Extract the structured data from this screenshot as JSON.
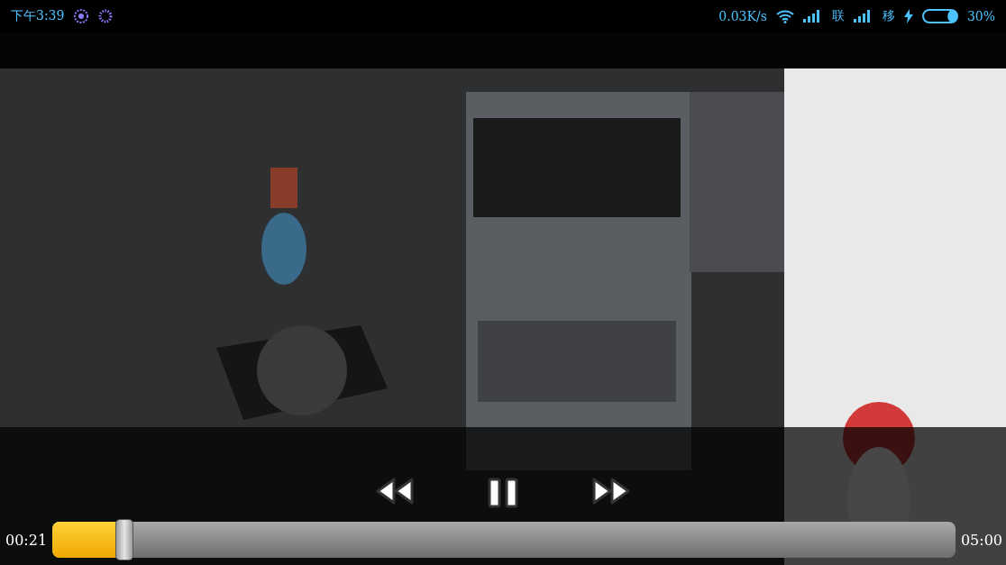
{
  "status_bar": {
    "time": "下午3:39",
    "speed": "0.03K/s",
    "carrier_1": "联",
    "carrier_2": "移",
    "battery": "30%",
    "charging": true
  },
  "player": {
    "paused": false,
    "elapsed": "00:21",
    "duration": "05:00",
    "level": 0.08
  }
}
